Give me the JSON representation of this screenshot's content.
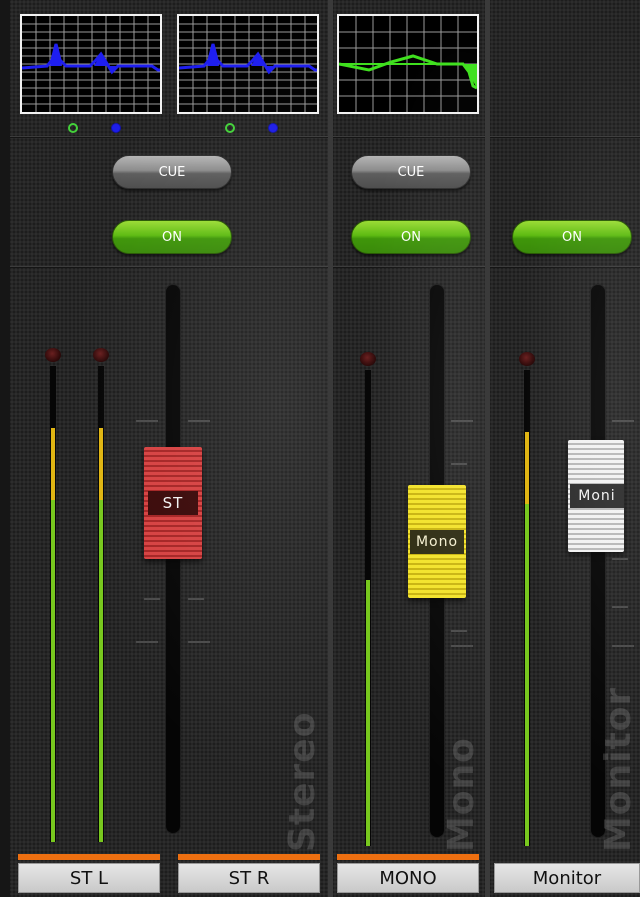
{
  "channels": {
    "stereo": {
      "cue_label": "CUE",
      "on_label": "ON",
      "fader_label": "ST",
      "watermark": "Stereo",
      "strips": [
        {
          "name": "ST L",
          "meter_level": 0.68,
          "yellow_start": 0.83
        },
        {
          "name": "ST R",
          "meter_level": 0.68,
          "yellow_start": 0.83
        }
      ],
      "fader_level": 0.58
    },
    "mono": {
      "cue_label": "CUE",
      "on_label": "ON",
      "fader_label": "Mono",
      "watermark": "Mono",
      "name": "MONO",
      "meter_level": 0.53,
      "fader_level": 0.53
    },
    "monitor": {
      "on_label": "ON",
      "fader_label": "Moni",
      "watermark": "Monitor",
      "name": "Monitor",
      "meter_level": 0.67,
      "yellow_start": 0.82,
      "fader_level": 0.62
    }
  },
  "colors": {
    "eq_curve_blue": "#1e1ef0",
    "eq_curve_green": "#3fe01e",
    "on_green": "#5ebb12",
    "accent_orange": "#ee6f10",
    "meter_green": "#78c81e",
    "meter_yellow": "#e0b512",
    "fader_red": "#d64141",
    "fader_yellow": "#f3e32a",
    "fader_white": "#f2f2f2"
  },
  "icons": {
    "eq_dot_1": "eq-on-ring-icon",
    "eq_dot_2": "eq-filled-dot-icon"
  }
}
